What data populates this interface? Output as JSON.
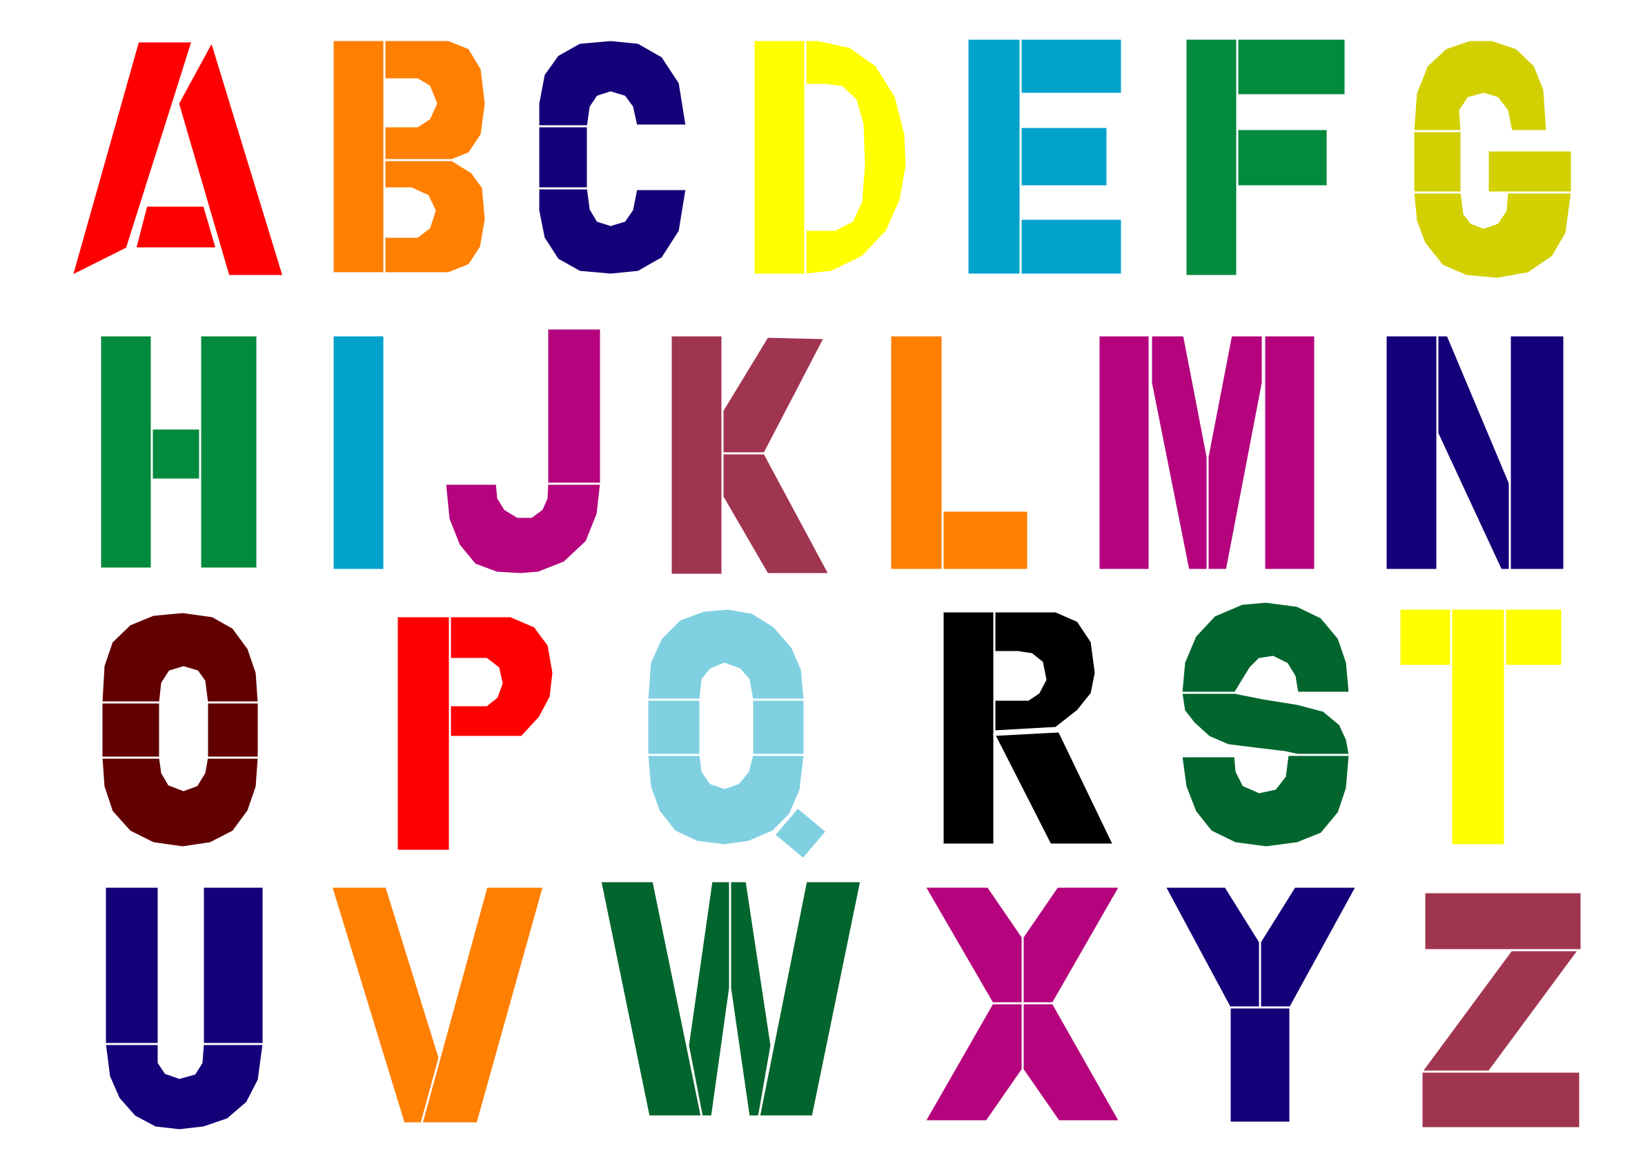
{
  "letters": [
    {
      "char": "A",
      "color": "#ff0000"
    },
    {
      "char": "B",
      "color": "#ff7f00"
    },
    {
      "char": "C",
      "color": "#140078"
    },
    {
      "char": "D",
      "color": "#ffff00"
    },
    {
      "char": "E",
      "color": "#02a2cb"
    },
    {
      "char": "F",
      "color": "#028a3d"
    },
    {
      "char": "G",
      "color": "#d2d000"
    },
    {
      "char": "H",
      "color": "#028a3d"
    },
    {
      "char": "I",
      "color": "#02a2cb"
    },
    {
      "char": "J",
      "color": "#b4037c"
    },
    {
      "char": "K",
      "color": "#a03550"
    },
    {
      "char": "L",
      "color": "#ff7f00"
    },
    {
      "char": "M",
      "color": "#b4037c"
    },
    {
      "char": "N",
      "color": "#140078"
    },
    {
      "char": "O",
      "color": "#620000"
    },
    {
      "char": "P",
      "color": "#ff0000"
    },
    {
      "char": "Q",
      "color": "#80d0e2"
    },
    {
      "char": "R",
      "color": "#000000"
    },
    {
      "char": "S",
      "color": "#02652d"
    },
    {
      "char": "T",
      "color": "#ffff00"
    },
    {
      "char": "U",
      "color": "#140078"
    },
    {
      "char": "V",
      "color": "#ff7f00"
    },
    {
      "char": "W",
      "color": "#02652d"
    },
    {
      "char": "X",
      "color": "#b4037c"
    },
    {
      "char": "Y",
      "color": "#140078"
    },
    {
      "char": "Z",
      "color": "#a03550"
    }
  ]
}
